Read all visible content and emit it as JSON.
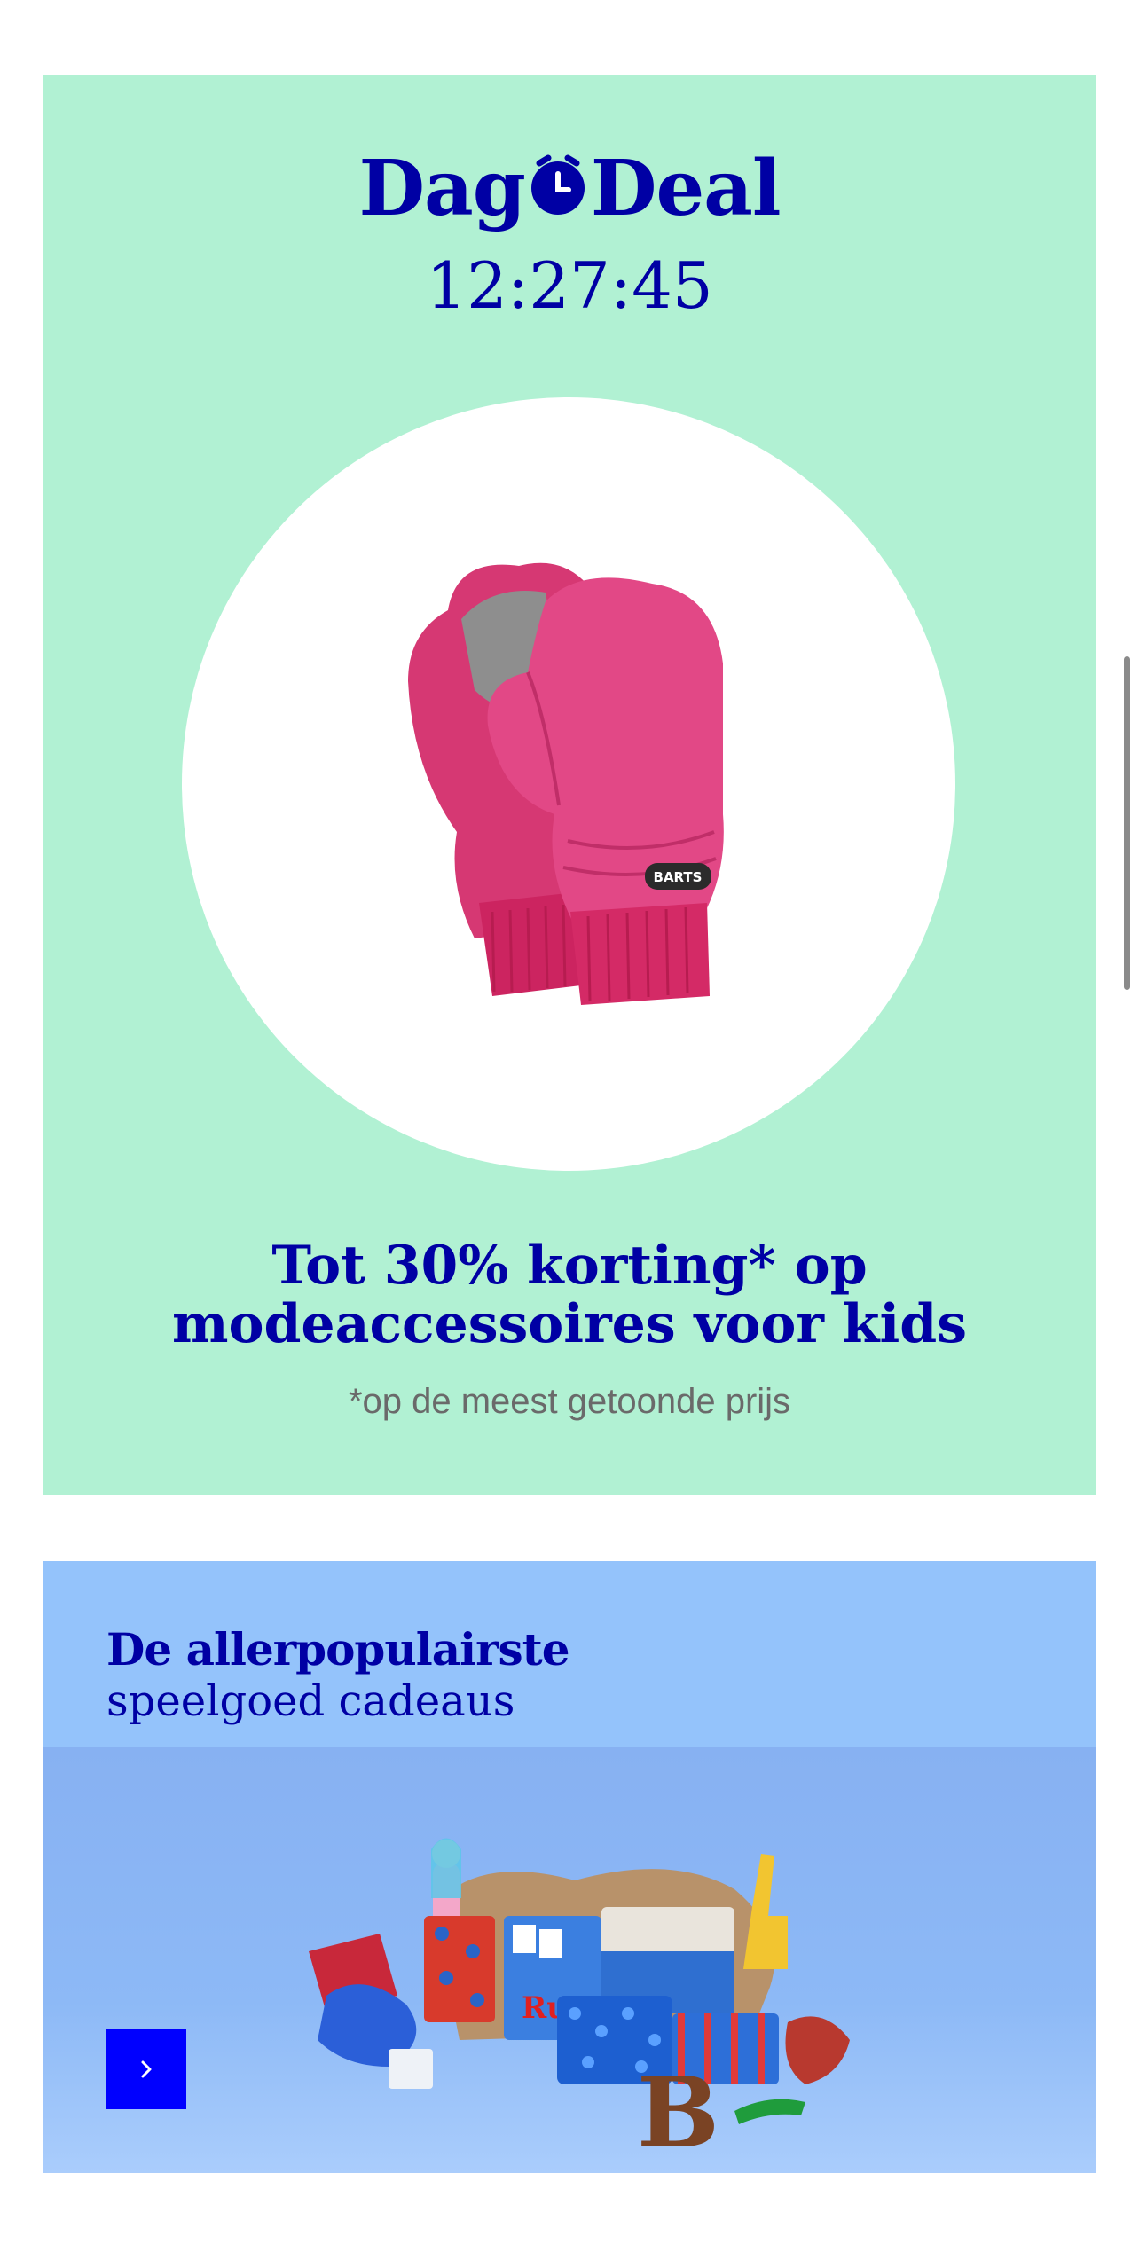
{
  "dagdeal": {
    "logo": {
      "part1": "Dag",
      "part2": "Deal"
    },
    "timer": "12:27:45",
    "product_image": {
      "alt": "Roze kinderwanten van Barts",
      "brand_label": "BARTS"
    },
    "headline": {
      "line1": "Tot 30% korting* op",
      "line2": "modeaccessoires voor kids"
    },
    "footnote": "*op de meest getoonde prijs"
  },
  "promo": {
    "title": "De allerpopulairste",
    "subtitle": "speelgoed cadeaus",
    "image": {
      "alt": "Stapel speelgoed cadeaus met pop, spellen en chocoladeletter"
    },
    "next_icon": "chevron-right-icon"
  },
  "colors": {
    "brand_blue": "#0000a4",
    "cta_blue": "#0000ff",
    "dagdeal_bg": "#b1f1d3",
    "promo_bg": "#93c5fd"
  }
}
